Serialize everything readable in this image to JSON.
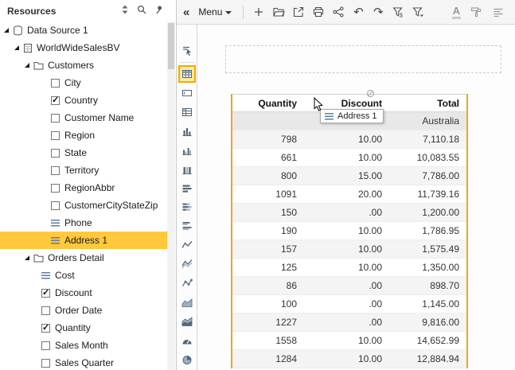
{
  "colors": {
    "accent": "#F2A900",
    "tree_selection": "#FFC83D",
    "table_selection_border": "#EFA51C"
  },
  "resources": {
    "title": "Resources",
    "header_icons": [
      "collapse-expand-icon",
      "search-icon",
      "pin-icon"
    ],
    "tree": [
      {
        "label": "Data Source 1",
        "icon": "database-icon",
        "expanded": true
      },
      {
        "label": "WorldWideSalesBV",
        "icon": "dataset-icon",
        "expanded": true
      },
      {
        "label": "Customers",
        "icon": "folder-icon",
        "expanded": true
      },
      {
        "label": "City",
        "icon": "checkbox-unchecked"
      },
      {
        "label": "Country",
        "icon": "checkbox-checked"
      },
      {
        "label": "Customer Name",
        "icon": "checkbox-unchecked"
      },
      {
        "label": "Region",
        "icon": "checkbox-unchecked"
      },
      {
        "label": "State",
        "icon": "checkbox-unchecked"
      },
      {
        "label": "Territory",
        "icon": "checkbox-unchecked"
      },
      {
        "label": "RegionAbbr",
        "icon": "checkbox-unchecked"
      },
      {
        "label": "CustomerCityStateZip",
        "icon": "checkbox-unchecked"
      },
      {
        "label": "Phone",
        "icon": "list-icon"
      },
      {
        "label": "Address 1",
        "icon": "list-icon",
        "selected": true
      },
      {
        "label": "Orders Detail",
        "icon": "folder-icon",
        "expanded": true
      },
      {
        "label": "Cost",
        "icon": "list-icon"
      },
      {
        "label": "Discount",
        "icon": "checkbox-checked"
      },
      {
        "label": "Order Date",
        "icon": "checkbox-unchecked"
      },
      {
        "label": "Quantity",
        "icon": "checkbox-checked"
      },
      {
        "label": "Sales Month",
        "icon": "checkbox-unchecked"
      },
      {
        "label": "Sales Quarter",
        "icon": "checkbox-unchecked"
      }
    ]
  },
  "toolbar": {
    "collapse_label": "«",
    "menu_label": "Menu",
    "glyphs": {
      "undo": "↶",
      "redo": "↷",
      "font_color": "A"
    },
    "icons": [
      "add-icon",
      "open-folder-icon",
      "export-icon",
      "print-icon",
      "share-icon",
      "undo-icon",
      "redo-icon",
      "filter-currency-icon",
      "filter-icon",
      "font-color-icon",
      "paint-roller-icon",
      "align-icon"
    ]
  },
  "component_tools": {
    "selected": "table",
    "items": [
      "pointer",
      "table",
      "textbox",
      "matrix",
      "column-chart",
      "column-chart-grouped",
      "column-chart-triple",
      "bar-chart",
      "bar-chart-stacked",
      "bar-chart-grouped",
      "sparkline",
      "sparkline-multi",
      "line-marker-chart",
      "area-chart",
      "area-chart-stacked",
      "gauge-chart",
      "pie-chart"
    ]
  },
  "report_table": {
    "columns": [
      "Quantity",
      "Discount",
      "Total"
    ],
    "group_row": "Australia",
    "rows": [
      [
        "798",
        "10.00",
        "7,110.18"
      ],
      [
        "661",
        "10.00",
        "10,083.55"
      ],
      [
        "800",
        "15.00",
        "7,786.00"
      ],
      [
        "1091",
        "20.00",
        "11,739.16"
      ],
      [
        "150",
        ".00",
        "1,200.00"
      ],
      [
        "190",
        "10.00",
        "1,786.95"
      ],
      [
        "157",
        "10.00",
        "1,575.49"
      ],
      [
        "125",
        "10.00",
        "1,350.00"
      ],
      [
        "86",
        ".00",
        "898.70"
      ],
      [
        "100",
        ".00",
        "1,145.00"
      ],
      [
        "1227",
        ".00",
        "9,816.00"
      ],
      [
        "1558",
        "10.00",
        "14,652.99"
      ],
      [
        "1284",
        "10.00",
        "12,884.94"
      ]
    ]
  },
  "drag_tooltip": {
    "label": "Address 1"
  }
}
